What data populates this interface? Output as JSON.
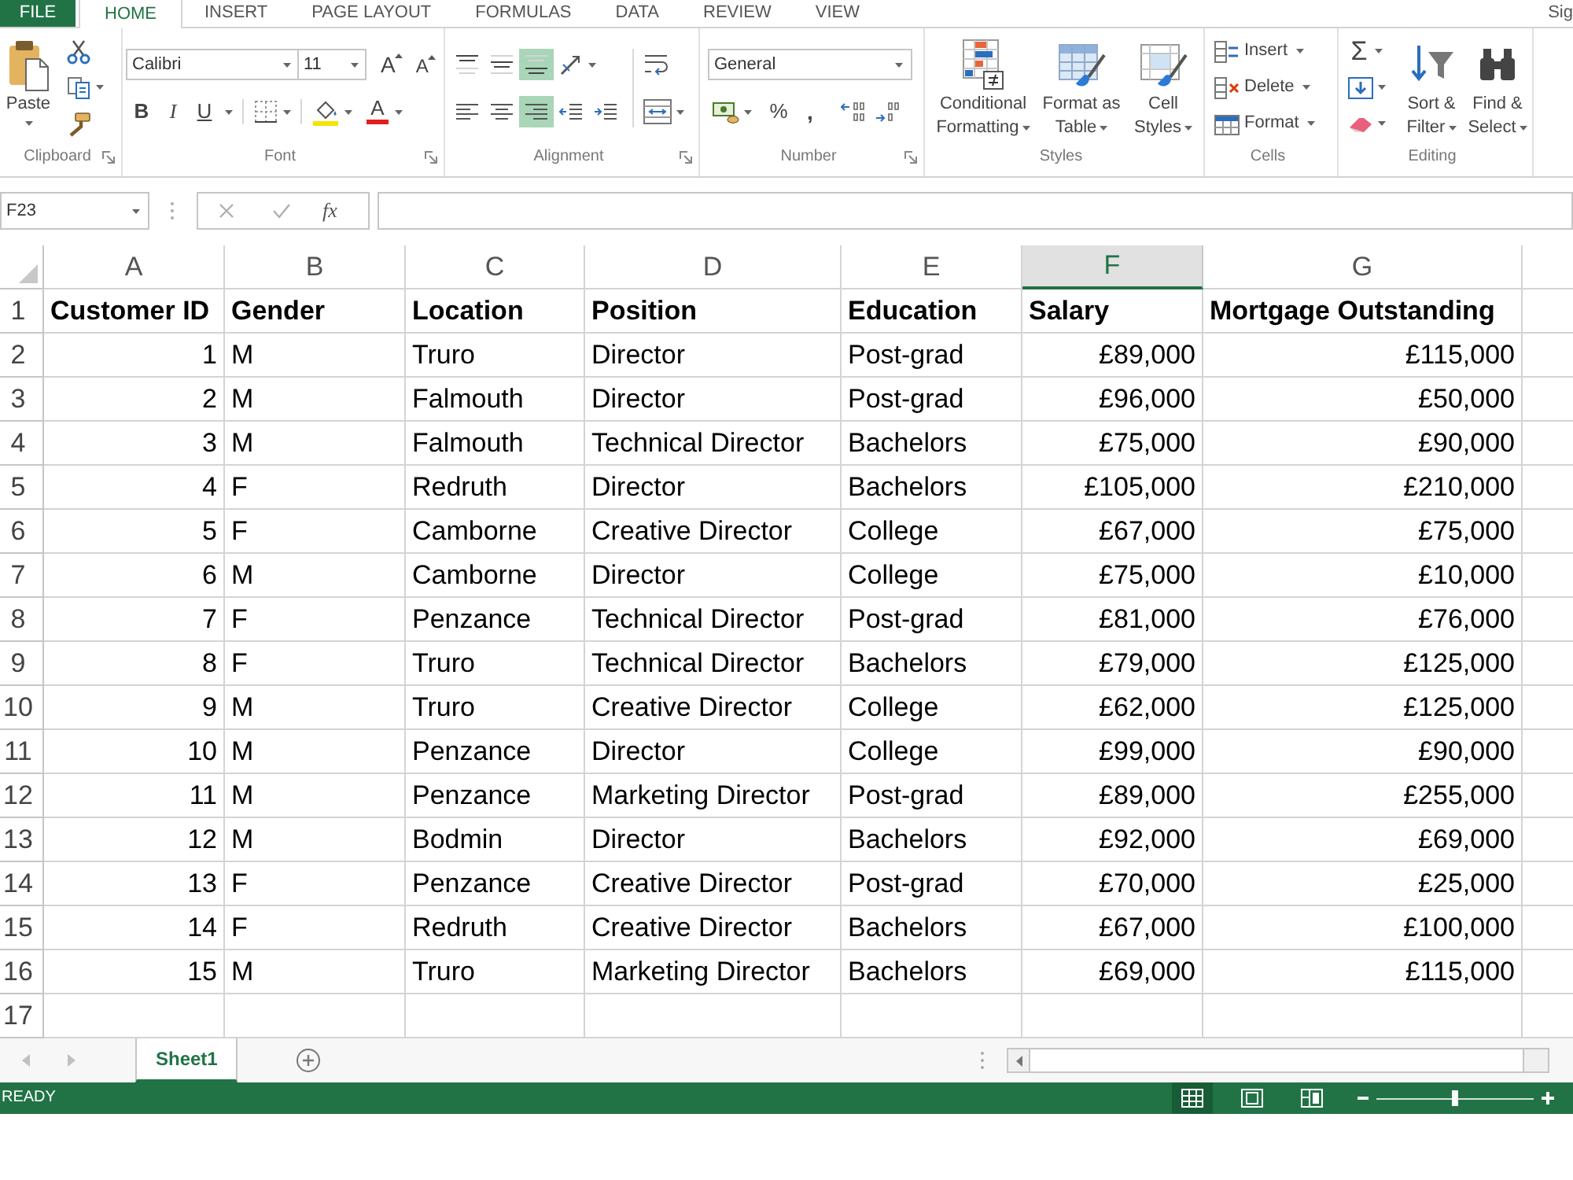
{
  "ribbon": {
    "tabs": [
      {
        "label": "FILE",
        "kind": "file",
        "selected": false
      },
      {
        "label": "HOME",
        "kind": "tab",
        "selected": true
      },
      {
        "label": "INSERT",
        "kind": "tab",
        "selected": false
      },
      {
        "label": "PAGE LAYOUT",
        "kind": "tab",
        "selected": false
      },
      {
        "label": "FORMULAS",
        "kind": "tab",
        "selected": false
      },
      {
        "label": "DATA",
        "kind": "tab",
        "selected": false
      },
      {
        "label": "REVIEW",
        "kind": "tab",
        "selected": false
      },
      {
        "label": "VIEW",
        "kind": "tab",
        "selected": false
      }
    ],
    "account": "Sig",
    "clipboard": {
      "label": "Clipboard",
      "paste": "Paste"
    },
    "font": {
      "label": "Font",
      "font_name": "Calibri",
      "font_size": "11",
      "grow": "A",
      "shrink": "A",
      "styles": [
        "B",
        "I",
        "U"
      ],
      "font_color": "A"
    },
    "alignment": {
      "label": "Alignment",
      "vertical": [
        {
          "selected": false
        },
        {
          "selected": false
        },
        {
          "selected": true
        }
      ],
      "horizontal": [
        {
          "selected": false
        },
        {
          "selected": false
        },
        {
          "selected": true
        }
      ]
    },
    "number": {
      "label": "Number",
      "format": "General",
      "percent": "%",
      "comma": ","
    },
    "styles": {
      "label": "Styles",
      "buttons": [
        {
          "label": [
            "Conditional",
            "Formatting"
          ]
        },
        {
          "label": [
            "Format as",
            "Table"
          ]
        },
        {
          "label": [
            "Cell",
            "Styles"
          ]
        }
      ]
    },
    "cells": {
      "label": "Cells",
      "buttons": [
        "Insert",
        "Delete",
        "Format"
      ]
    },
    "editing": {
      "label": "Editing",
      "autosum": "Σ",
      "buttons": [
        {
          "label": [
            "Sort &",
            "Filter"
          ]
        },
        {
          "label": [
            "Find &",
            "Select"
          ]
        }
      ]
    }
  },
  "formula_bar": {
    "name_box": "F23",
    "function": "fx"
  },
  "sheet": {
    "columns": [
      {
        "label": "A",
        "kind": "number",
        "selected": false
      },
      {
        "label": "B",
        "kind": "text",
        "selected": false
      },
      {
        "label": "C",
        "kind": "text",
        "selected": false
      },
      {
        "label": "D",
        "kind": "text",
        "selected": false
      },
      {
        "label": "E",
        "kind": "text",
        "selected": false
      },
      {
        "label": "F",
        "kind": "number",
        "selected": true
      },
      {
        "label": "G",
        "kind": "number",
        "selected": false
      }
    ],
    "rows": [
      {
        "number": "1",
        "kind": "header",
        "cells": [
          "Customer ID",
          "Gender",
          "Location",
          "Position",
          "Education",
          "Salary",
          "Mortgage Outstanding"
        ]
      },
      {
        "number": "2",
        "kind": "data",
        "cells": [
          "1",
          "M",
          "Truro",
          "Director",
          "Post-grad",
          "£89,000",
          "£115,000"
        ]
      },
      {
        "number": "3",
        "kind": "data",
        "cells": [
          "2",
          "M",
          "Falmouth",
          "Director",
          "Post-grad",
          "£96,000",
          "£50,000"
        ]
      },
      {
        "number": "4",
        "kind": "data",
        "cells": [
          "3",
          "M",
          "Falmouth",
          "Technical Director",
          "Bachelors",
          "£75,000",
          "£90,000"
        ]
      },
      {
        "number": "5",
        "kind": "data",
        "cells": [
          "4",
          "F",
          "Redruth",
          "Director",
          "Bachelors",
          "£105,000",
          "£210,000"
        ]
      },
      {
        "number": "6",
        "kind": "data",
        "cells": [
          "5",
          "F",
          "Camborne",
          "Creative Director",
          "College",
          "£67,000",
          "£75,000"
        ]
      },
      {
        "number": "7",
        "kind": "data",
        "cells": [
          "6",
          "M",
          "Camborne",
          "Director",
          "College",
          "£75,000",
          "£10,000"
        ]
      },
      {
        "number": "8",
        "kind": "data",
        "cells": [
          "7",
          "F",
          "Penzance",
          "Technical Director",
          "Post-grad",
          "£81,000",
          "£76,000"
        ]
      },
      {
        "number": "9",
        "kind": "data",
        "cells": [
          "8",
          "F",
          "Truro",
          "Technical Director",
          "Bachelors",
          "£79,000",
          "£125,000"
        ]
      },
      {
        "number": "10",
        "kind": "data",
        "cells": [
          "9",
          "M",
          "Truro",
          "Creative Director",
          "College",
          "£62,000",
          "£125,000"
        ]
      },
      {
        "number": "11",
        "kind": "data",
        "cells": [
          "10",
          "M",
          "Penzance",
          "Director",
          "College",
          "£99,000",
          "£90,000"
        ]
      },
      {
        "number": "12",
        "kind": "data",
        "cells": [
          "11",
          "M",
          "Penzance",
          "Marketing Director",
          "Post-grad",
          "£89,000",
          "£255,000"
        ]
      },
      {
        "number": "13",
        "kind": "data",
        "cells": [
          "12",
          "M",
          "Bodmin",
          "Director",
          "Bachelors",
          "£92,000",
          "£69,000"
        ]
      },
      {
        "number": "14",
        "kind": "data",
        "cells": [
          "13",
          "F",
          "Penzance",
          "Creative Director",
          "Post-grad",
          "£70,000",
          "£25,000"
        ]
      },
      {
        "number": "15",
        "kind": "data",
        "cells": [
          "14",
          "F",
          "Redruth",
          "Creative Director",
          "Bachelors",
          "£67,000",
          "£100,000"
        ]
      },
      {
        "number": "16",
        "kind": "data",
        "cells": [
          "15",
          "M",
          "Truro",
          "Marketing Director",
          "Bachelors",
          "£69,000",
          "£115,000"
        ]
      },
      {
        "number": "17",
        "kind": "data"
      }
    ]
  },
  "sheet_tabs": [
    {
      "label": "Sheet1",
      "selected": true
    }
  ],
  "status_bar": {
    "status": "READY",
    "views": [
      {
        "selected": true
      },
      {
        "selected": false
      },
      {
        "selected": false
      }
    ],
    "zoom": {
      "level": 0.5
    }
  }
}
